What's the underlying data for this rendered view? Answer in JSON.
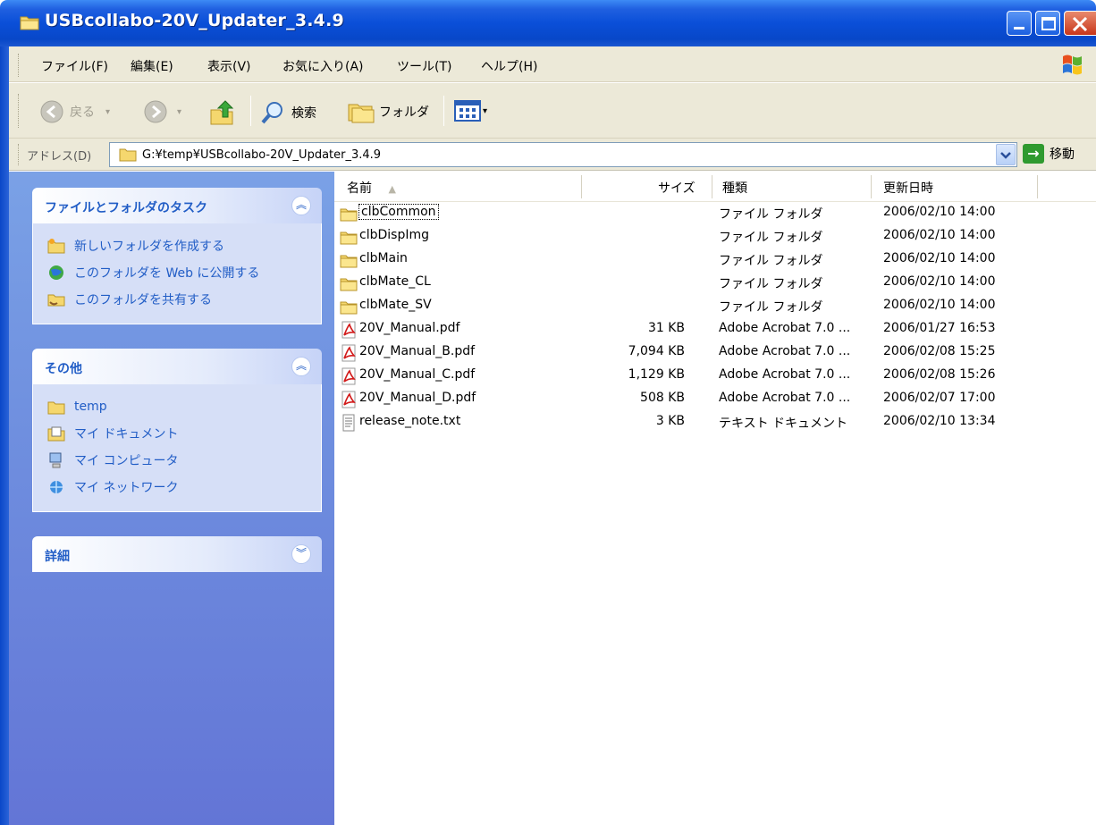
{
  "window": {
    "title": "USBcollabo-20V_Updater_3.4.9",
    "controls": {
      "minimize": "minimize",
      "maximize": "maximize",
      "close": "close"
    }
  },
  "menubar": {
    "items": [
      "ファイル(F)",
      "編集(E)",
      "表示(V)",
      "お気に入り(A)",
      "ツール(T)",
      "ヘルプ(H)"
    ]
  },
  "toolbar": {
    "back_label": "戻る",
    "search_label": "検索",
    "folders_label": "フォルダ"
  },
  "addressbar": {
    "label": "アドレス(D)",
    "path": "G:¥temp¥USBcollabo-20V_Updater_3.4.9",
    "go_label": "移動"
  },
  "taskpane": {
    "file_tasks": {
      "title": "ファイルとフォルダのタスク",
      "items": [
        "新しいフォルダを作成する",
        "このフォルダを Web に公開する",
        "このフォルダを共有する"
      ]
    },
    "other_places": {
      "title": "その他",
      "items": [
        "temp",
        "マイ ドキュメント",
        "マイ コンピュータ",
        "マイ ネットワーク"
      ]
    },
    "details": {
      "title": "詳細"
    }
  },
  "filelist": {
    "columns": {
      "name": "名前",
      "size": "サイズ",
      "type": "種類",
      "modified": "更新日時"
    },
    "rows": [
      {
        "icon": "folder-icon",
        "name": "clbCommon",
        "size": "",
        "type": "ファイル フォルダ",
        "modified": "2006/02/10 14:00"
      },
      {
        "icon": "folder-icon",
        "name": "clbDispImg",
        "size": "",
        "type": "ファイル フォルダ",
        "modified": "2006/02/10 14:00"
      },
      {
        "icon": "folder-icon",
        "name": "clbMain",
        "size": "",
        "type": "ファイル フォルダ",
        "modified": "2006/02/10 14:00"
      },
      {
        "icon": "folder-icon",
        "name": "clbMate_CL",
        "size": "",
        "type": "ファイル フォルダ",
        "modified": "2006/02/10 14:00"
      },
      {
        "icon": "folder-icon",
        "name": "clbMate_SV",
        "size": "",
        "type": "ファイル フォルダ",
        "modified": "2006/02/10 14:00"
      },
      {
        "icon": "pdf-icon",
        "name": "20V_Manual.pdf",
        "size": "31 KB",
        "type": "Adobe Acrobat 7.0 ...",
        "modified": "2006/01/27 16:53"
      },
      {
        "icon": "pdf-icon",
        "name": "20V_Manual_B.pdf",
        "size": "7,094 KB",
        "type": "Adobe Acrobat 7.0 ...",
        "modified": "2006/02/08 15:25"
      },
      {
        "icon": "pdf-icon",
        "name": "20V_Manual_C.pdf",
        "size": "1,129 KB",
        "type": "Adobe Acrobat 7.0 ...",
        "modified": "2006/02/08 15:26"
      },
      {
        "icon": "pdf-icon",
        "name": "20V_Manual_D.pdf",
        "size": "508 KB",
        "type": "Adobe Acrobat 7.0 ...",
        "modified": "2006/02/07 17:00"
      },
      {
        "icon": "text-file-icon",
        "name": "release_note.txt",
        "size": "3 KB",
        "type": "テキスト ドキュメント",
        "modified": "2006/02/10 13:34"
      }
    ]
  },
  "colors": {
    "title_bar": "#0a4fd8",
    "task_pane": "#6f8fdf",
    "task_link": "#215dc6",
    "chrome": "#ece9d8"
  }
}
